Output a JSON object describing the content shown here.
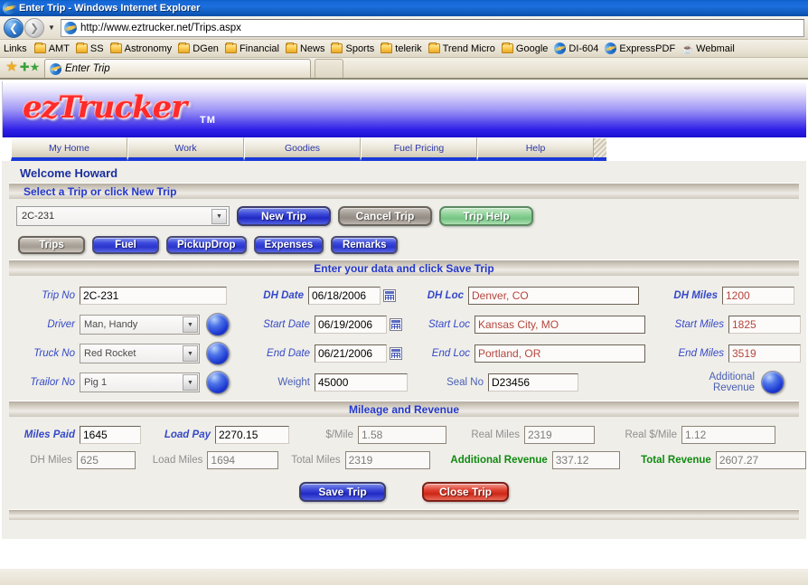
{
  "window": {
    "title": "Enter Trip - Windows Internet Explorer",
    "app_icon": "ie-logo-icon"
  },
  "browser": {
    "back_icon": "back-arrow-icon",
    "forward_icon": "forward-arrow-icon",
    "history_icon": "chevron-down-icon",
    "url": "http://www.eztrucker.net/Trips.aspx",
    "url_icon": "ie-page-icon",
    "links_label": "Links",
    "links": [
      {
        "label": "AMT",
        "icon": "folder-icon"
      },
      {
        "label": "SS",
        "icon": "folder-icon"
      },
      {
        "label": "Astronomy",
        "icon": "folder-icon"
      },
      {
        "label": "DGen",
        "icon": "folder-icon"
      },
      {
        "label": "Financial",
        "icon": "folder-icon"
      },
      {
        "label": "News",
        "icon": "folder-icon"
      },
      {
        "label": "Sports",
        "icon": "folder-icon"
      },
      {
        "label": "telerik",
        "icon": "folder-icon"
      },
      {
        "label": "Trend Micro",
        "icon": "folder-icon"
      },
      {
        "label": "Google",
        "icon": "folder-icon"
      },
      {
        "label": "DI-604",
        "icon": "ie-page-icon"
      },
      {
        "label": "ExpressPDF",
        "icon": "ie-page-icon"
      },
      {
        "label": "Webmail",
        "icon": "coffee-cup-icon"
      }
    ],
    "favorites_icon": "star-icon",
    "add_favorite_icon": "add-star-icon",
    "tab_label": "Enter Trip",
    "tab_icon": "ie-page-icon"
  },
  "site": {
    "logo_text": "ezTrucker",
    "trademark": "TM",
    "nav_tabs": [
      {
        "label": "My Home"
      },
      {
        "label": "Work"
      },
      {
        "label": "Goodies"
      },
      {
        "label": "Fuel Pricing"
      },
      {
        "label": "Help"
      }
    ]
  },
  "page": {
    "welcome": "Welcome Howard",
    "select_bar": "Select a Trip or click New Trip",
    "enter_data_bar": "Enter your data and click Save Trip",
    "mileage_bar": "Mileage and Revenue"
  },
  "trip_selector": {
    "value": "2C-231",
    "dropdown_icon": "chevron-down-icon",
    "buttons": [
      {
        "label": "New Trip",
        "style": "blue"
      },
      {
        "label": "Cancel Trip",
        "style": "gray"
      },
      {
        "label": "Trip Help",
        "style": "green"
      }
    ]
  },
  "sub_tabs": [
    {
      "label": "Trips",
      "active": true
    },
    {
      "label": "Fuel",
      "active": false
    },
    {
      "label": "PickupDrop",
      "active": false
    },
    {
      "label": "Expenses",
      "active": false
    },
    {
      "label": "Remarks",
      "active": false
    }
  ],
  "form": {
    "trip_no": {
      "label": "Trip No",
      "value": "2C-231"
    },
    "driver": {
      "label": "Driver",
      "value": "Man, Handy",
      "orb_icon": "blue-orb-icon"
    },
    "truck_no": {
      "label": "Truck No",
      "value": "Red Rocket",
      "orb_icon": "blue-orb-icon"
    },
    "trailor_no": {
      "label": "Trailor No",
      "value": "Pig 1",
      "orb_icon": "blue-orb-icon"
    },
    "dh_date": {
      "label": "DH Date",
      "value": "06/18/2006",
      "calendar_icon": "calendar-icon"
    },
    "start_date": {
      "label": "Start Date",
      "value": "06/19/2006",
      "calendar_icon": "calendar-icon"
    },
    "end_date": {
      "label": "End Date",
      "value": "06/21/2006",
      "calendar_icon": "calendar-icon"
    },
    "weight": {
      "label": "Weight",
      "value": "45000"
    },
    "dh_loc": {
      "label": "DH Loc",
      "value": "Denver, CO"
    },
    "start_loc": {
      "label": "Start Loc",
      "value": "Kansas City, MO"
    },
    "end_loc": {
      "label": "End Loc",
      "value": "Portland, OR"
    },
    "seal_no": {
      "label": "Seal No",
      "value": "D23456"
    },
    "dh_miles": {
      "label": "DH Miles",
      "value": "1200"
    },
    "start_miles": {
      "label": "Start Miles",
      "value": "1825"
    },
    "end_miles": {
      "label": "End Miles",
      "value": "3519"
    },
    "additional_revenue_btn": {
      "label_line1": "Additional",
      "label_line2": "Revenue",
      "orb_icon": "blue-orb-icon"
    }
  },
  "mileage": {
    "miles_paid": {
      "label": "Miles Paid",
      "value": "1645"
    },
    "load_pay": {
      "label": "Load Pay",
      "value": "2270.15"
    },
    "per_mile": {
      "label": "$/Mile",
      "value": "1.58"
    },
    "real_miles": {
      "label": "Real Miles",
      "value": "2319"
    },
    "real_per_mile": {
      "label": "Real $/Mile",
      "value": "1.12"
    },
    "dh_miles": {
      "label": "DH Miles",
      "value": "625"
    },
    "load_miles": {
      "label": "Load Miles",
      "value": "1694"
    },
    "total_miles": {
      "label": "Total Miles",
      "value": "2319"
    },
    "additional_revenue": {
      "label": "Additional Revenue",
      "value": "337.12"
    },
    "total_revenue": {
      "label": "Total Revenue",
      "value": "2607.27"
    }
  },
  "actions": {
    "save": "Save Trip",
    "close": "Close Trip"
  },
  "colors": {
    "accent_blue": "#3549c8",
    "banner_blue": "#2029c4",
    "logo_red": "#ff2a2a",
    "revenue_green": "#108a10",
    "value_red": "#b4463c"
  }
}
